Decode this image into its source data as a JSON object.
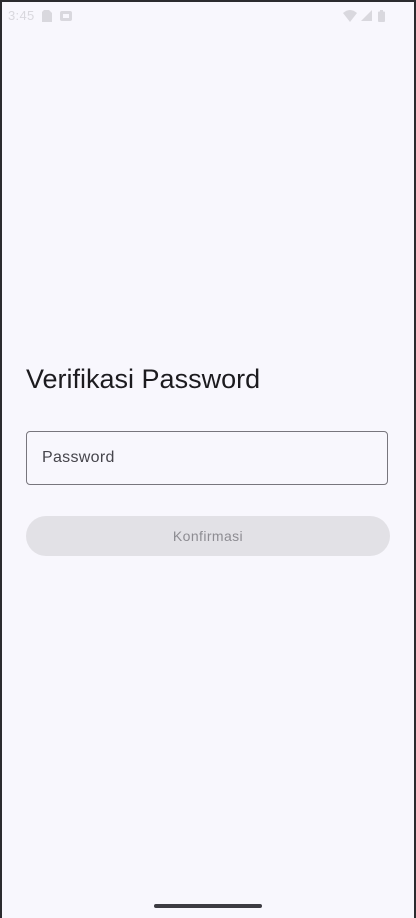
{
  "status_bar": {
    "time": "3:45",
    "left_icons": [
      "sim-card-icon",
      "notification-icon"
    ],
    "right_icons": [
      "wifi-icon",
      "signal-icon",
      "battery-icon"
    ]
  },
  "screen": {
    "title": "Verifikasi Password",
    "password_field": {
      "placeholder": "Password",
      "value": ""
    },
    "confirm_button": {
      "label": "Konfirmasi",
      "enabled": false
    }
  },
  "colors": {
    "background": "#f8f7fd",
    "text_primary": "#1c1b1f",
    "field_outline": "#78767d",
    "button_disabled_bg": "#e2e1e6",
    "button_disabled_text": "#8d8c92"
  }
}
